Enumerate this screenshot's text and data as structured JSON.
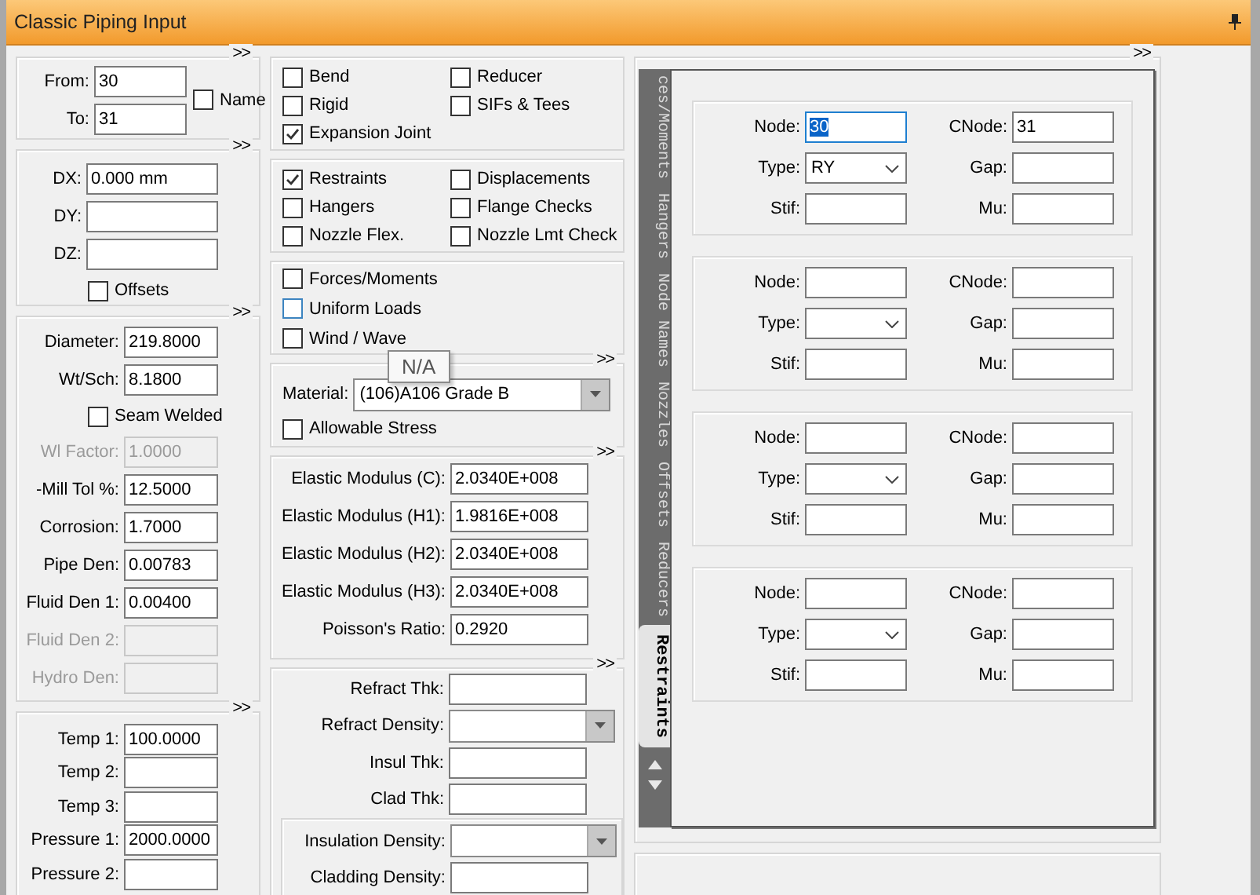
{
  "window": {
    "title": "Classic Piping Input"
  },
  "node_group": {
    "expander": ">>",
    "from": {
      "label": "From:",
      "value": "30"
    },
    "to": {
      "label": "To:",
      "value": "31"
    },
    "name_option": {
      "label": "Name",
      "checked": false
    }
  },
  "delta_group": {
    "expander": ">>",
    "fields": [
      {
        "label": "DX:",
        "value": "0.000 mm"
      },
      {
        "label": "DY:"
      },
      {
        "label": "DZ:"
      }
    ],
    "offsets": {
      "label": "Offsets",
      "checked": false
    }
  },
  "pipe_group": {
    "expander": ">>",
    "items": [
      {
        "kind": "field",
        "label": "Diameter:",
        "value": "219.8000",
        "disabled": false
      },
      {
        "kind": "field",
        "label": "Wt/Sch:",
        "value": "8.1800",
        "disabled": false
      },
      {
        "kind": "check",
        "label": "Seam Welded",
        "checked": false
      },
      {
        "kind": "field",
        "label": "Wl Factor:",
        "value": "1.0000",
        "disabled": true
      },
      {
        "kind": "field",
        "label": "-Mill Tol %:",
        "value": "12.5000",
        "disabled": false
      },
      {
        "kind": "field",
        "label": "Corrosion:",
        "value": "1.7000",
        "disabled": false
      },
      {
        "kind": "field",
        "label": "Pipe Den:",
        "value": "0.00783",
        "disabled": false
      },
      {
        "kind": "field",
        "label": "Fluid Den 1:",
        "value": "0.00400",
        "disabled": false
      },
      {
        "kind": "field",
        "label": "Fluid Den 2:",
        "disabled": true
      },
      {
        "kind": "field",
        "label": "Hydro Den:",
        "disabled": true
      }
    ]
  },
  "temperature_group": {
    "expander": ">>",
    "fields": [
      {
        "label": "Temp 1:",
        "value": "100.0000"
      },
      {
        "label": "Temp 2:"
      },
      {
        "label": "Temp 3:"
      },
      {
        "label": "Pressure 1:",
        "value": "2000.0000"
      },
      {
        "label": "Pressure 2:"
      }
    ]
  },
  "element_options": [
    {
      "kind": "grid",
      "options": [
        {
          "label": "Bend",
          "checked": false
        },
        {
          "label": "Reducer",
          "checked": false
        },
        {
          "label": "Rigid",
          "checked": false
        },
        {
          "label": "SIFs & Tees",
          "checked": false
        },
        {
          "label": "Expansion Joint",
          "checked": true
        }
      ]
    },
    {
      "kind": "grid",
      "options": [
        {
          "label": "Restraints",
          "checked": true
        },
        {
          "label": "Displacements",
          "checked": false
        },
        {
          "label": "Hangers",
          "checked": false
        },
        {
          "label": "Flange Checks",
          "checked": false
        },
        {
          "label": "Nozzle Flex.",
          "checked": false
        },
        {
          "label": "Nozzle Lmt Check",
          "checked": false
        }
      ]
    },
    {
      "kind": "list",
      "options": [
        {
          "label": "Forces/Moments",
          "checked": false,
          "focused": false
        },
        {
          "label": "Uniform Loads",
          "checked": false,
          "focused": true
        },
        {
          "label": "Wind / Wave",
          "checked": false,
          "focused": false
        }
      ]
    }
  ],
  "tooltip": {
    "text": "N/A"
  },
  "material_group": {
    "expander": ">>",
    "material": {
      "label": "Material:",
      "value": "(106)A106 Grade B"
    },
    "allowable_stress": {
      "label": "Allowable Stress",
      "checked": false
    }
  },
  "elastic_group": {
    "expander": ">>",
    "fields": [
      {
        "label": "Elastic Modulus (C):",
        "value": "2.0340E+008"
      },
      {
        "label": "Elastic Modulus (H1):",
        "value": "1.9816E+008"
      },
      {
        "label": "Elastic Modulus (H2):",
        "value": "2.0340E+008"
      },
      {
        "label": "Elastic Modulus (H3):",
        "value": "2.0340E+008"
      },
      {
        "label": "Poisson's Ratio:",
        "value": "0.2920"
      }
    ]
  },
  "insulation_group": {
    "expander": ">>",
    "fields": [
      {
        "kind": "field",
        "label": "Refract Thk:"
      },
      {
        "kind": "dropdown",
        "label": "Refract Density:"
      },
      {
        "kind": "field",
        "label": "Insul Thk:"
      },
      {
        "kind": "field",
        "label": "Clad Thk:"
      }
    ],
    "inset_fields": [
      {
        "kind": "dropdown",
        "label": "Insulation Density:"
      },
      {
        "kind": "field",
        "label": "Cladding Density:"
      }
    ]
  },
  "side_tabs": [
    {
      "label": "ces/Moments",
      "selected": false
    },
    {
      "label": "Hangers",
      "selected": false
    },
    {
      "label": "Node Names",
      "selected": false
    },
    {
      "label": "Nozzles",
      "selected": false
    },
    {
      "label": "Offsets",
      "selected": false
    },
    {
      "label": "Reducers",
      "selected": false
    },
    {
      "label": "Restraints",
      "selected": true
    }
  ],
  "restraints_panel": {
    "expander": ">>",
    "blocks": [
      {
        "fields": [
          {
            "kind": "field",
            "label": "Node:",
            "value": "30",
            "focused": true
          },
          {
            "kind": "field",
            "label": "CNode:",
            "value": "31",
            "focused": false
          },
          {
            "kind": "dropdown",
            "label": "Type:",
            "value": "RY",
            "focused": false
          },
          {
            "kind": "field",
            "label": "Gap:",
            "focused": false
          },
          {
            "kind": "field",
            "label": "Stif:",
            "focused": false
          },
          {
            "kind": "field",
            "label": "Mu:",
            "focused": false
          }
        ]
      },
      {
        "fields": [
          {
            "kind": "field",
            "label": "Node:",
            "focused": false
          },
          {
            "kind": "field",
            "label": "CNode:",
            "focused": false
          },
          {
            "kind": "dropdown",
            "label": "Type:",
            "focused": false
          },
          {
            "kind": "field",
            "label": "Gap:",
            "focused": false
          },
          {
            "kind": "field",
            "label": "Stif:",
            "focused": false
          },
          {
            "kind": "field",
            "label": "Mu:",
            "focused": false
          }
        ]
      },
      {
        "fields": [
          {
            "kind": "field",
            "label": "Node:",
            "focused": false
          },
          {
            "kind": "field",
            "label": "CNode:",
            "focused": false
          },
          {
            "kind": "dropdown",
            "label": "Type:",
            "focused": false
          },
          {
            "kind": "field",
            "label": "Gap:",
            "focused": false
          },
          {
            "kind": "field",
            "label": "Stif:",
            "focused": false
          },
          {
            "kind": "field",
            "label": "Mu:",
            "focused": false
          }
        ]
      },
      {
        "fields": [
          {
            "kind": "field",
            "label": "Node:",
            "focused": false
          },
          {
            "kind": "field",
            "label": "CNode:",
            "focused": false
          },
          {
            "kind": "dropdown",
            "label": "Type:",
            "focused": false
          },
          {
            "kind": "field",
            "label": "Gap:",
            "focused": false
          },
          {
            "kind": "field",
            "label": "Stif:",
            "focused": false
          },
          {
            "kind": "field",
            "label": "Mu:",
            "focused": false
          }
        ]
      }
    ]
  }
}
